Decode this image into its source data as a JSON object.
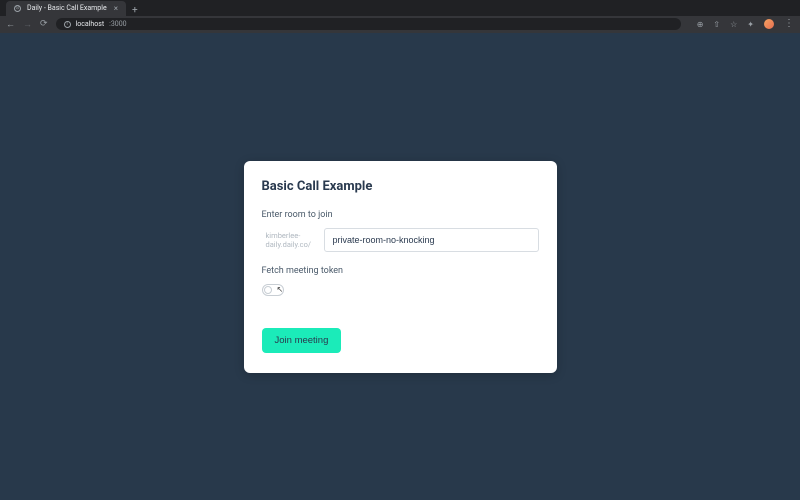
{
  "browser": {
    "tab_title": "Daily - Basic Call Example",
    "url_host": "localhost",
    "url_port": ":3000"
  },
  "card": {
    "title": "Basic Call Example",
    "room_label": "Enter room to join",
    "room_prefix": "kimberlee-daily.daily.co/",
    "room_value": "private-room-no-knocking",
    "token_label": "Fetch meeting token",
    "join_button": "Join meeting"
  }
}
